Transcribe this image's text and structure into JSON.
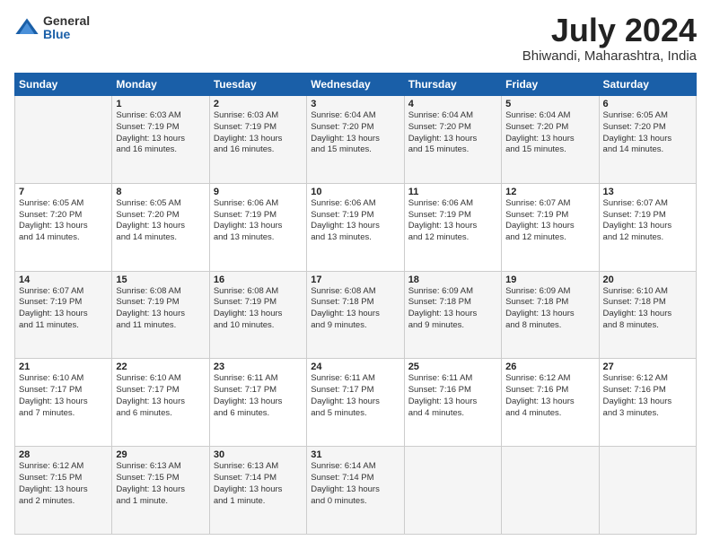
{
  "header": {
    "logo": {
      "general": "General",
      "blue": "Blue"
    },
    "month_year": "July 2024",
    "location": "Bhiwandi, Maharashtra, India"
  },
  "calendar": {
    "days_of_week": [
      "Sunday",
      "Monday",
      "Tuesday",
      "Wednesday",
      "Thursday",
      "Friday",
      "Saturday"
    ],
    "weeks": [
      [
        {
          "day": "",
          "content": ""
        },
        {
          "day": "1",
          "content": "Sunrise: 6:03 AM\nSunset: 7:19 PM\nDaylight: 13 hours\nand 16 minutes."
        },
        {
          "day": "2",
          "content": "Sunrise: 6:03 AM\nSunset: 7:19 PM\nDaylight: 13 hours\nand 16 minutes."
        },
        {
          "day": "3",
          "content": "Sunrise: 6:04 AM\nSunset: 7:20 PM\nDaylight: 13 hours\nand 15 minutes."
        },
        {
          "day": "4",
          "content": "Sunrise: 6:04 AM\nSunset: 7:20 PM\nDaylight: 13 hours\nand 15 minutes."
        },
        {
          "day": "5",
          "content": "Sunrise: 6:04 AM\nSunset: 7:20 PM\nDaylight: 13 hours\nand 15 minutes."
        },
        {
          "day": "6",
          "content": "Sunrise: 6:05 AM\nSunset: 7:20 PM\nDaylight: 13 hours\nand 14 minutes."
        }
      ],
      [
        {
          "day": "7",
          "content": "Sunrise: 6:05 AM\nSunset: 7:20 PM\nDaylight: 13 hours\nand 14 minutes."
        },
        {
          "day": "8",
          "content": "Sunrise: 6:05 AM\nSunset: 7:20 PM\nDaylight: 13 hours\nand 14 minutes."
        },
        {
          "day": "9",
          "content": "Sunrise: 6:06 AM\nSunset: 7:19 PM\nDaylight: 13 hours\nand 13 minutes."
        },
        {
          "day": "10",
          "content": "Sunrise: 6:06 AM\nSunset: 7:19 PM\nDaylight: 13 hours\nand 13 minutes."
        },
        {
          "day": "11",
          "content": "Sunrise: 6:06 AM\nSunset: 7:19 PM\nDaylight: 13 hours\nand 12 minutes."
        },
        {
          "day": "12",
          "content": "Sunrise: 6:07 AM\nSunset: 7:19 PM\nDaylight: 13 hours\nand 12 minutes."
        },
        {
          "day": "13",
          "content": "Sunrise: 6:07 AM\nSunset: 7:19 PM\nDaylight: 13 hours\nand 12 minutes."
        }
      ],
      [
        {
          "day": "14",
          "content": "Sunrise: 6:07 AM\nSunset: 7:19 PM\nDaylight: 13 hours\nand 11 minutes."
        },
        {
          "day": "15",
          "content": "Sunrise: 6:08 AM\nSunset: 7:19 PM\nDaylight: 13 hours\nand 11 minutes."
        },
        {
          "day": "16",
          "content": "Sunrise: 6:08 AM\nSunset: 7:19 PM\nDaylight: 13 hours\nand 10 minutes."
        },
        {
          "day": "17",
          "content": "Sunrise: 6:08 AM\nSunset: 7:18 PM\nDaylight: 13 hours\nand 9 minutes."
        },
        {
          "day": "18",
          "content": "Sunrise: 6:09 AM\nSunset: 7:18 PM\nDaylight: 13 hours\nand 9 minutes."
        },
        {
          "day": "19",
          "content": "Sunrise: 6:09 AM\nSunset: 7:18 PM\nDaylight: 13 hours\nand 8 minutes."
        },
        {
          "day": "20",
          "content": "Sunrise: 6:10 AM\nSunset: 7:18 PM\nDaylight: 13 hours\nand 8 minutes."
        }
      ],
      [
        {
          "day": "21",
          "content": "Sunrise: 6:10 AM\nSunset: 7:17 PM\nDaylight: 13 hours\nand 7 minutes."
        },
        {
          "day": "22",
          "content": "Sunrise: 6:10 AM\nSunset: 7:17 PM\nDaylight: 13 hours\nand 6 minutes."
        },
        {
          "day": "23",
          "content": "Sunrise: 6:11 AM\nSunset: 7:17 PM\nDaylight: 13 hours\nand 6 minutes."
        },
        {
          "day": "24",
          "content": "Sunrise: 6:11 AM\nSunset: 7:17 PM\nDaylight: 13 hours\nand 5 minutes."
        },
        {
          "day": "25",
          "content": "Sunrise: 6:11 AM\nSunset: 7:16 PM\nDaylight: 13 hours\nand 4 minutes."
        },
        {
          "day": "26",
          "content": "Sunrise: 6:12 AM\nSunset: 7:16 PM\nDaylight: 13 hours\nand 4 minutes."
        },
        {
          "day": "27",
          "content": "Sunrise: 6:12 AM\nSunset: 7:16 PM\nDaylight: 13 hours\nand 3 minutes."
        }
      ],
      [
        {
          "day": "28",
          "content": "Sunrise: 6:12 AM\nSunset: 7:15 PM\nDaylight: 13 hours\nand 2 minutes."
        },
        {
          "day": "29",
          "content": "Sunrise: 6:13 AM\nSunset: 7:15 PM\nDaylight: 13 hours\nand 1 minute."
        },
        {
          "day": "30",
          "content": "Sunrise: 6:13 AM\nSunset: 7:14 PM\nDaylight: 13 hours\nand 1 minute."
        },
        {
          "day": "31",
          "content": "Sunrise: 6:14 AM\nSunset: 7:14 PM\nDaylight: 13 hours\nand 0 minutes."
        },
        {
          "day": "",
          "content": ""
        },
        {
          "day": "",
          "content": ""
        },
        {
          "day": "",
          "content": ""
        }
      ]
    ]
  }
}
